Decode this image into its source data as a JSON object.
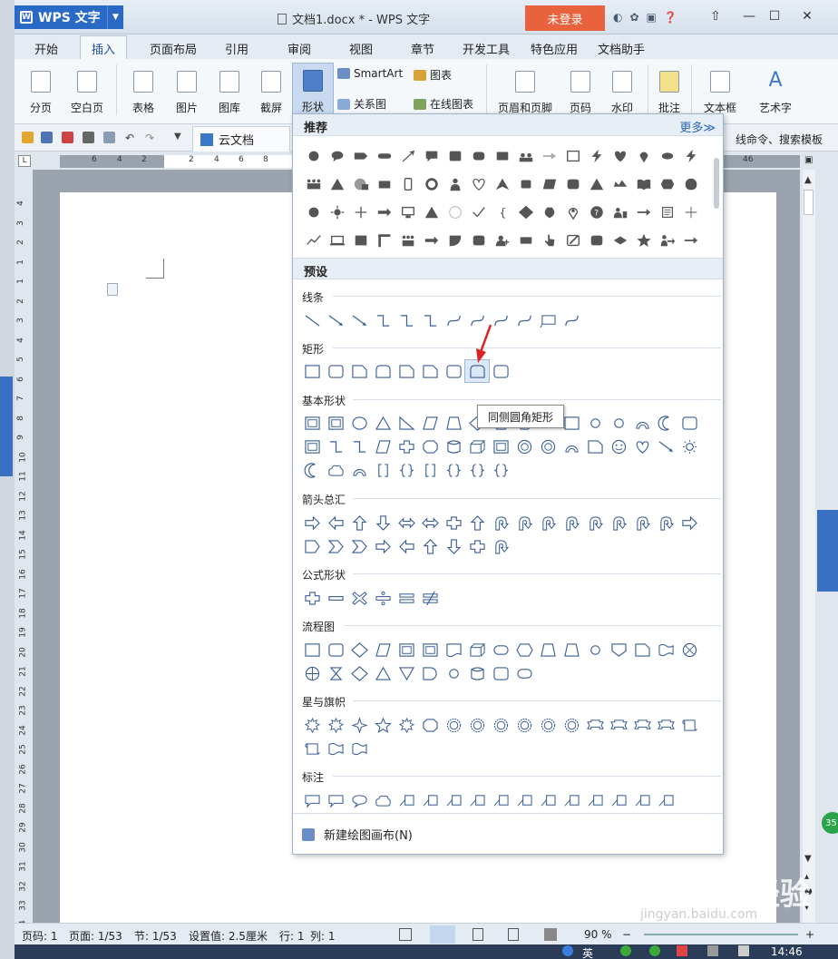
{
  "app": {
    "name": "WPS 文字",
    "document_title": "文档1.docx * - WPS 文字",
    "login_label": "未登录"
  },
  "menu_tabs": [
    "开始",
    "插入",
    "页面布局",
    "引用",
    "审阅",
    "视图",
    "章节",
    "开发工具",
    "特色应用",
    "文档助手"
  ],
  "active_tab": "插入",
  "ribbon": {
    "page_break": "分页",
    "blank_page": "空白页",
    "table": "表格",
    "picture": "图片",
    "gallery": "图库",
    "screenshot": "截屏",
    "shapes": "形状",
    "smartart": "SmartArt",
    "chart": "图表",
    "relation": "关系图",
    "online_chart": "在线图表",
    "header_footer": "页眉和页脚",
    "page_number": "页码",
    "watermark": "水印",
    "comment": "批注",
    "textbox": "文本框",
    "art_text": "艺术字"
  },
  "quickbar": {
    "cloud_doc_tab": "云文档",
    "right_text": "线命令、搜索模板"
  },
  "ruler": {
    "h_ticks": [
      "6",
      "4",
      "2",
      "2",
      "4",
      "6",
      "8"
    ],
    "h_ticks_right": "46",
    "v_ticks": [
      "4",
      "3",
      "2",
      "1",
      "1",
      "2",
      "3",
      "4",
      "5",
      "6",
      "7",
      "8",
      "9",
      "10",
      "11",
      "12",
      "13",
      "14",
      "15",
      "16",
      "17",
      "18",
      "19",
      "20",
      "21",
      "22",
      "23",
      "24",
      "25",
      "26",
      "27",
      "28",
      "29",
      "30",
      "31",
      "32",
      "33",
      "34"
    ]
  },
  "panel": {
    "recommended_title": "推荐",
    "more_label": "更多≫",
    "preset_title": "预设",
    "sections": {
      "lines": "线条",
      "rects": "矩形",
      "basic": "基本形状",
      "arrows": "箭头总汇",
      "formula": "公式形状",
      "flowchart": "流程图",
      "stars": "星与旗帜",
      "callouts": "标注"
    },
    "tooltip": "同侧圆角矩形",
    "new_canvas": "新建绘图画布(N)"
  },
  "statusbar": {
    "page_no": "页码: 1",
    "page": "页面: 1/53",
    "section": "节: 1/53",
    "setting": "设置值: 2.5厘米",
    "row": "行: 1",
    "col": "列: 1",
    "zoom": "90 %"
  },
  "taskbar": {
    "ime": "英",
    "time": "14:46"
  },
  "side_badge": "35",
  "watermark": {
    "brand": "Baidu 经验",
    "url": "jingyan.baidu.com"
  },
  "colors": {
    "accent": "#2b69c6",
    "login": "#e8623e",
    "shape_stroke": "#3a5f96",
    "shape_fill": "#f2f2f2"
  }
}
